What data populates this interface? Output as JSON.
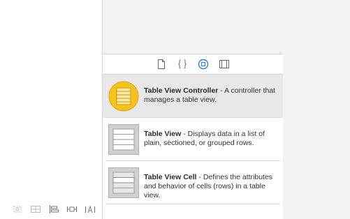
{
  "canvas_toolbar": {
    "icons": [
      "canvas-resolve-icon",
      "embed-in-stack-icon",
      "align-icon",
      "pin-icon",
      "resolve-layout-icon"
    ]
  },
  "library_tabs": [
    {
      "name": "file-inspector-tab",
      "icon": "document-icon",
      "selected": false
    },
    {
      "name": "quick-help-tab",
      "icon": "braces-icon",
      "selected": false
    },
    {
      "name": "object-library-tab",
      "icon": "object-circle-icon",
      "selected": true
    },
    {
      "name": "media-library-tab",
      "icon": "film-icon",
      "selected": false
    }
  ],
  "library_items": [
    {
      "title": "Table View Controller",
      "description": " - A controller that manages a table view.",
      "icon": "table-view-controller-icon",
      "selected": true
    },
    {
      "title": "Table View",
      "description": " - Displays data in a list of plain, sectioned, or grouped rows.",
      "icon": "table-view-icon",
      "selected": false
    },
    {
      "title": "Table View Cell",
      "description": " - Defines the attributes and behavior of cells (rows) in a table view.",
      "icon": "table-view-cell-icon",
      "selected": false
    }
  ],
  "colors": {
    "accent_blue": "#2a7de1",
    "controller_yellow": "#f7c21b",
    "panel_gray": "#f3f3f3",
    "selected_row": "#e8e8e8"
  }
}
